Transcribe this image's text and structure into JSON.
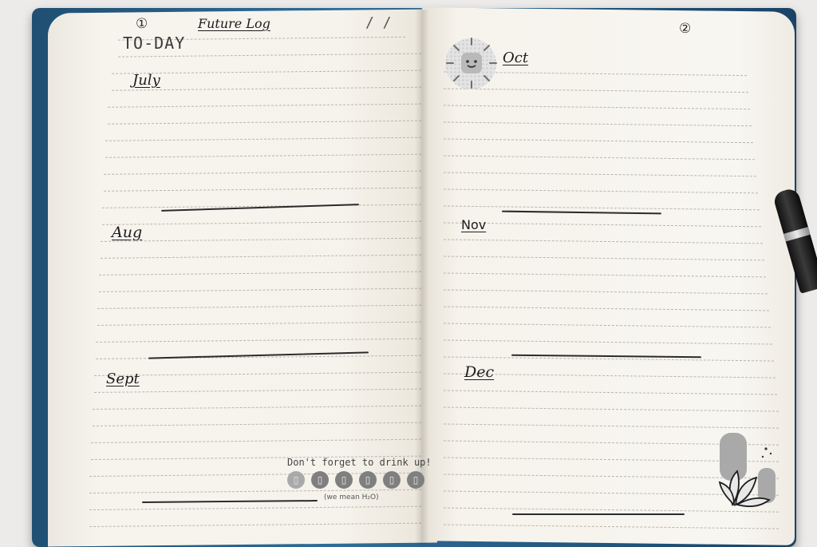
{
  "left_page": {
    "page_number": "①",
    "logo": "TO-DAY",
    "title": "Future Log",
    "date_slash": "/ /",
    "months": [
      "July",
      "Aug",
      "Sept"
    ],
    "sticker": {
      "headline": "Don't forget to drink up!",
      "note": "(we mean H₂O)",
      "cup_count": 6
    }
  },
  "right_page": {
    "page_number": "②",
    "months": [
      "Oct",
      "Nov",
      "Dec"
    ]
  },
  "icons": [
    "sun-sticker-icon",
    "water-glass-icon",
    "leaf-sticker-icon",
    "pen-icon"
  ],
  "colors": {
    "paper": "#f6f3ec",
    "cover": "#2f6d99",
    "ink": "#1c1c1c",
    "table": "#ecebe9"
  }
}
